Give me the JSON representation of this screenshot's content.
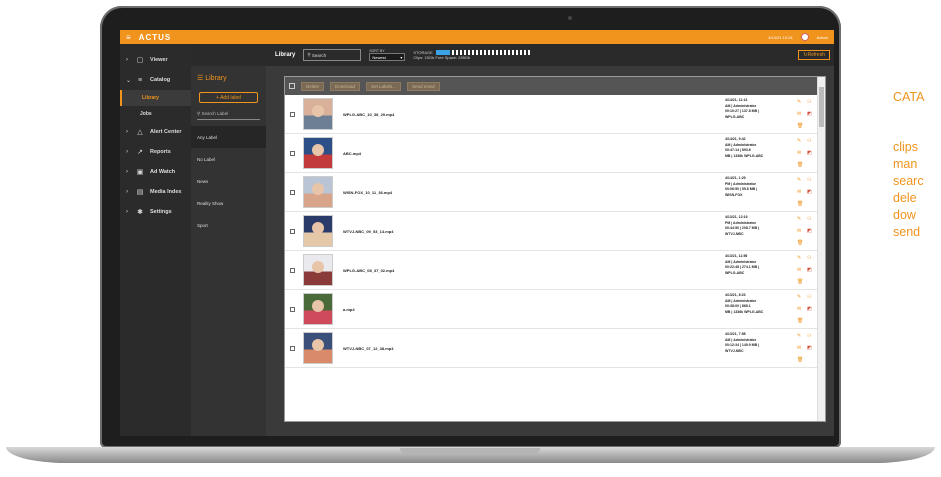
{
  "app": {
    "logo": "ACTUS",
    "menu_glyph": "≡",
    "top_right_text": "4/14/21 10:24",
    "user": "Admin"
  },
  "sidebar": {
    "items": [
      {
        "icon": "▢",
        "label": "Viewer",
        "chev": "›"
      },
      {
        "icon": "≡",
        "label": "Catalog",
        "chev": "⌄"
      },
      {
        "icon": "△",
        "label": "Alert Center",
        "chev": "›"
      },
      {
        "icon": "↗",
        "label": "Reports",
        "chev": "›"
      },
      {
        "icon": "▣",
        "label": "Ad Watch",
        "chev": "›"
      },
      {
        "icon": "▤",
        "label": "Media Index",
        "chev": "›"
      },
      {
        "icon": "✱",
        "label": "Settings",
        "chev": "›"
      }
    ],
    "sub_items": [
      {
        "label": "Library"
      },
      {
        "label": "Jobs"
      }
    ]
  },
  "labels": {
    "title": "Library",
    "add_label": "+ Add label",
    "search_placeholder": "Search Label",
    "items": [
      "Any Label",
      "No Label",
      "News",
      "Reality Show",
      "Sport"
    ]
  },
  "header": {
    "title": "Library",
    "search_placeholder": "Search",
    "sort_caption": "SORT BY",
    "sort_value": "Newest",
    "storage_caption": "STORAGE",
    "storage_text": "Clips: 15Gb    Free Space: 285Gb",
    "storage_fraction": 0.15,
    "refresh": "Refresh"
  },
  "toolbar": {
    "buttons": [
      "Delete",
      "Download",
      "Set Labels...",
      "Send email"
    ]
  },
  "rows": [
    {
      "file": "WPLG-ABC_10_38_29.mp4",
      "meta": [
        "4/14/21, 11:13",
        "AM | Administrator",
        "00:10:27 | 137.8 MB |",
        "WPLG-ABC"
      ],
      "colors": [
        "#d9b19a",
        "#6d7f95"
      ]
    },
    {
      "file": "ABC.mp4",
      "meta": [
        "4/14/21, 9:42",
        "AM | Administrator",
        "00:47:14 | 893.6",
        "MB | 1336k WPLG-ABC"
      ],
      "colors": [
        "#2d4f88",
        "#c23a3a"
      ]
    },
    {
      "file": "WISN-FOX_10_11_36.mp4",
      "meta": [
        "4/14/21, 1:29",
        "PM | Administrator",
        "00:06:50 | 55.8 MB |",
        "WISN-FOX"
      ],
      "colors": [
        "#b9c4d4",
        "#d8a48a"
      ]
    },
    {
      "file": "WTVJ-NBC_09_53_14.mp4",
      "meta": [
        "4/13/21, 12:16",
        "PM | Administrator",
        "00:44:50 | 208.7 MB |",
        "WTVJ-NBC"
      ],
      "colors": [
        "#2a3b6a",
        "#e5c8a8"
      ]
    },
    {
      "file": "WPLG-ABC_08_37_02.mp4",
      "meta": [
        "4/13/21, 11:56",
        "AM | Administrator",
        "00:22:48 | 274.1 MB |",
        "WPLG-ABC"
      ],
      "colors": [
        "#e9e9ee",
        "#8b3a3a"
      ]
    },
    {
      "file": "a.mp4",
      "meta": [
        "4/13/21, 8:23",
        "AM | Administrator",
        "00:38:00 | 868.1",
        "MB | 1336k WPLG-ABC"
      ],
      "colors": [
        "#4b6a3a",
        "#cf4a5a"
      ]
    },
    {
      "file": "WTVJ-NBC_07_12_38.mp4",
      "meta": [
        "4/13/21, 7:58",
        "AM | Administrator",
        "00:12:34 | 149.9 MB |",
        "WTVJ-NBC"
      ],
      "colors": [
        "#3a4f7a",
        "#d98a6a"
      ]
    }
  ],
  "right_text": {
    "lines": [
      "CATA",
      "clips",
      "man",
      "searc",
      "dele",
      "dow",
      "send"
    ]
  },
  "colors": {
    "accent": "#f0941e",
    "sidebar": "#2b2b2b"
  }
}
